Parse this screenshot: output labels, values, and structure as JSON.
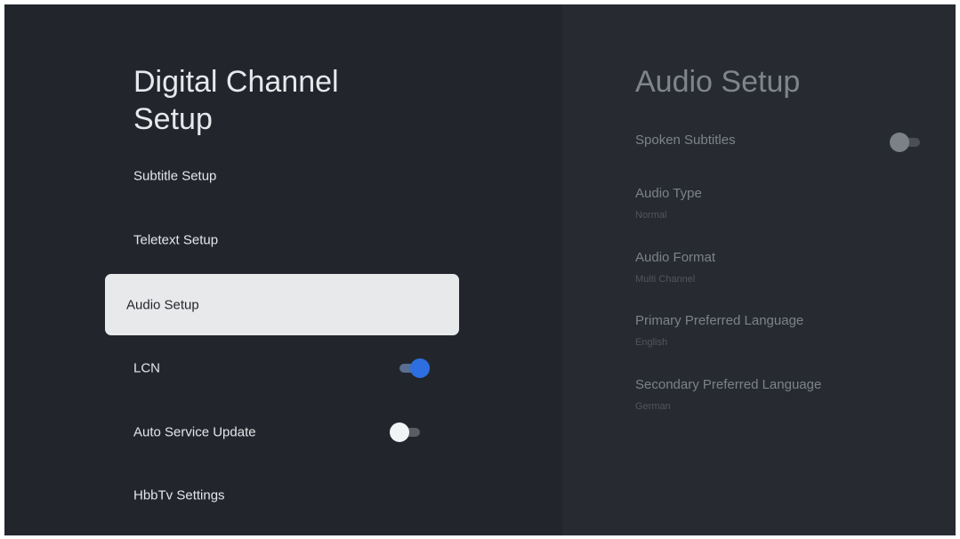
{
  "left_panel": {
    "title": "Digital Channel Setup",
    "items": [
      {
        "label": "Subtitle Setup"
      },
      {
        "label": "Teletext Setup"
      },
      {
        "label": "Audio Setup",
        "selected": true
      },
      {
        "label": "LCN",
        "toggle": "on"
      },
      {
        "label": "Auto Service Update",
        "toggle": "off"
      },
      {
        "label": "HbbTv Settings"
      }
    ]
  },
  "right_panel": {
    "title": "Audio Setup",
    "settings": [
      {
        "label": "Spoken Subtitles",
        "toggle": "off"
      },
      {
        "label": "Audio Type",
        "value": "Normal"
      },
      {
        "label": "Audio Format",
        "value": "Multi Channel"
      },
      {
        "label": "Primary Preferred Language",
        "value": "English"
      },
      {
        "label": "Secondary Preferred Language",
        "value": "German"
      }
    ]
  },
  "colors": {
    "background": "#22262c",
    "right_panel_background": "#272b31",
    "selected_item": "#e8e9eb",
    "toggle_on": "#2d6fe0"
  }
}
